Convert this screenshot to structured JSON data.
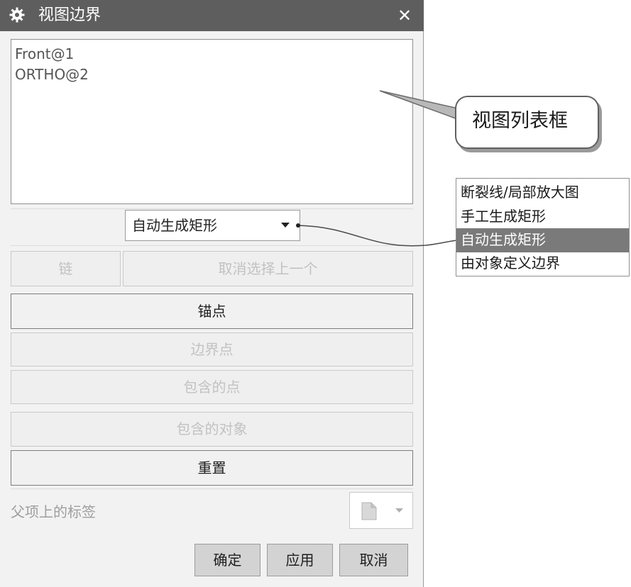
{
  "dialog": {
    "title": "视图边界",
    "close_label": "✕",
    "view_list": [
      "Front@1",
      "ORTHO@2"
    ],
    "boundary_type": "自动生成矩形",
    "buttons": {
      "chain": "链",
      "deselect_last": "取消选择上一个",
      "anchor": "锚点",
      "boundary_point": "边界点",
      "contained_point": "包含的点",
      "contained_object": "包含的对象",
      "reset": "重置"
    },
    "parent_label": "父项上的标签",
    "actions": {
      "ok": "确定",
      "apply": "应用",
      "cancel": "取消"
    }
  },
  "annotations": {
    "callout_text": "视图列表框",
    "dropdown_options": [
      "断裂线/局部放大图",
      "手工生成矩形",
      "自动生成矩形",
      "由对象定义边界"
    ],
    "selected_option": "自动生成矩形"
  },
  "icons": {
    "title": "gear-icon",
    "close": "close-icon",
    "dropdown": "caret-down-icon",
    "label_picker": "document-icon",
    "label_picker_arrow": "caret-down-icon"
  },
  "colors": {
    "titlebar": "#5e5e5e",
    "dialog_bg": "#f2f2f2",
    "selected_option_bg": "#7a7a7a",
    "disabled_text": "#c2c2c2"
  }
}
